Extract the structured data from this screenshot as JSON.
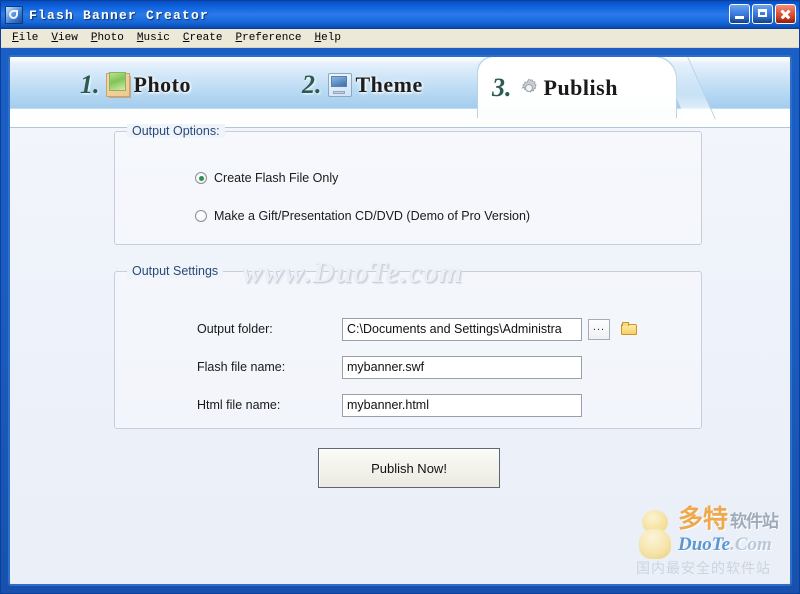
{
  "window": {
    "title": "Flash Banner Creator",
    "icon": "app-icon",
    "buttons": {
      "minimize": "minimize-icon",
      "maximize": "maximize-icon",
      "close": "close-icon"
    }
  },
  "menu": {
    "items": [
      {
        "label": "File",
        "accel": "F"
      },
      {
        "label": "View",
        "accel": "V"
      },
      {
        "label": "Photo",
        "accel": "P"
      },
      {
        "label": "Music",
        "accel": "M"
      },
      {
        "label": "Create",
        "accel": "C"
      },
      {
        "label": "Preference",
        "accel": "P"
      },
      {
        "label": "Help",
        "accel": "H"
      }
    ]
  },
  "tabs": [
    {
      "number": "1.",
      "label": "Photo",
      "icon": "photo-icon",
      "active": false
    },
    {
      "number": "2.",
      "label": "Theme",
      "icon": "monitor-icon",
      "active": false
    },
    {
      "number": "3.",
      "label": "Publish",
      "icon": "gear-icon",
      "active": true
    }
  ],
  "output_options": {
    "title": "Output Options:",
    "choices": [
      {
        "label": "Create Flash File Only",
        "selected": true
      },
      {
        "label": "Make a Gift/Presentation CD/DVD (Demo of Pro Version)",
        "selected": false
      }
    ]
  },
  "output_settings": {
    "title": "Output Settings",
    "fields": [
      {
        "label": "Output folder:",
        "value": "C:\\Documents and Settings\\Administra",
        "browse_label": "...",
        "folder_icon": "open-folder-icon"
      },
      {
        "label": "Flash file name:",
        "value": "mybanner.swf"
      },
      {
        "label": "Html file name:",
        "value": "mybanner.html"
      }
    ]
  },
  "actions": {
    "publish_label": "Publish Now!"
  },
  "watermarks": {
    "center": "www.DuoTe.com",
    "corner_cn": "多特",
    "corner_cn_sub": "软件站",
    "corner_en_bright": "DuoTe",
    "corner_en_dim": ".Com",
    "corner_slogan": "国内最安全的软件站"
  },
  "colors": {
    "title_bar": "#1064dd",
    "client_blue": "#1b5fc4",
    "accent_green": "#2f8f4e",
    "panel_bg": "#eef2fa",
    "close_red": "#e2583a"
  }
}
